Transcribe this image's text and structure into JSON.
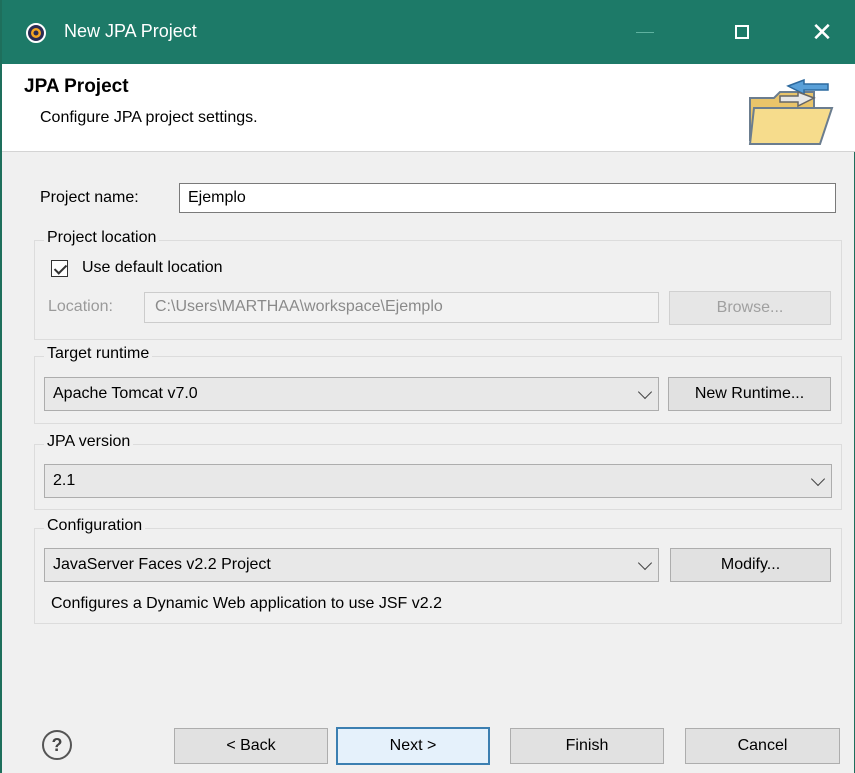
{
  "window": {
    "title": "New JPA Project",
    "controls": {
      "minimize": "—",
      "maximize": "□",
      "close": "✕"
    }
  },
  "header": {
    "title": "JPA Project",
    "description": "Configure JPA project settings.",
    "icon": "folder-icon"
  },
  "project_name": {
    "label": "Project name:",
    "value": "Ejemplo"
  },
  "project_location": {
    "group_label": "Project location",
    "use_default_label": "Use default location",
    "use_default_checked": true,
    "location_label": "Location:",
    "location_value": "C:\\Users\\MARTHAA\\workspace\\Ejemplo",
    "browse_label": "Browse..."
  },
  "target_runtime": {
    "group_label": "Target runtime",
    "selected": "Apache Tomcat v7.0",
    "new_runtime_label": "New Runtime..."
  },
  "jpa_version": {
    "group_label": "JPA version",
    "selected": "2.1"
  },
  "configuration": {
    "group_label": "Configuration",
    "selected": "JavaServer Faces v2.2 Project",
    "modify_label": "Modify...",
    "description": "Configures a Dynamic Web application to use JSF v2.2"
  },
  "footer": {
    "help_icon": "help-icon",
    "help_glyph": "?",
    "back_label": "< Back",
    "next_label": "Next >",
    "finish_label": "Finish",
    "cancel_label": "Cancel"
  },
  "colors": {
    "titlebar": "#1d7a68",
    "default_button_border": "#3c7fb1"
  }
}
